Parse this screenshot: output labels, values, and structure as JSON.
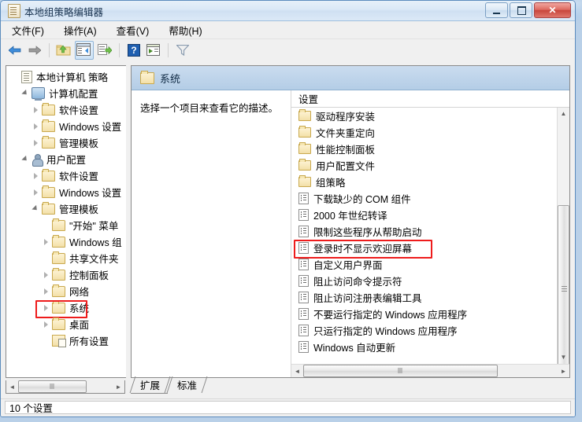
{
  "window": {
    "title": "本地组策略编辑器",
    "app_icon": "policy-document-icon",
    "buttons": {
      "minimize": "minimize",
      "maximize": "maximize",
      "close": "✕"
    }
  },
  "menubar": {
    "items": [
      {
        "label": "文件(F)",
        "name": "menu-file"
      },
      {
        "label": "操作(A)",
        "name": "menu-action"
      },
      {
        "label": "查看(V)",
        "name": "menu-view"
      },
      {
        "label": "帮助(H)",
        "name": "menu-help"
      }
    ]
  },
  "toolbar": {
    "items": [
      {
        "name": "back-icon",
        "glyph": "←"
      },
      {
        "name": "forward-icon",
        "glyph": "→"
      },
      {
        "name": "up-folder-icon",
        "glyph": "↑"
      },
      {
        "name": "show-hide-tree-icon",
        "glyph": "▤"
      },
      {
        "name": "export-list-icon",
        "glyph": "➦"
      },
      {
        "name": "help-icon",
        "glyph": "?"
      },
      {
        "name": "properties-icon",
        "glyph": "▦"
      },
      {
        "name": "filter-icon",
        "glyph": "▽"
      }
    ]
  },
  "tree": {
    "root_label": "本地计算机 策略",
    "nodes": [
      {
        "label": "本地计算机 策略",
        "indent": 0,
        "icon": "policy-document-icon",
        "twist": "none",
        "highlight": false
      },
      {
        "label": "计算机配置",
        "indent": 1,
        "icon": "computer-icon",
        "twist": "expanded",
        "highlight": false
      },
      {
        "label": "软件设置",
        "indent": 2,
        "icon": "folder-icon",
        "twist": "collapsed",
        "highlight": false
      },
      {
        "label": "Windows 设置",
        "indent": 2,
        "icon": "folder-icon",
        "twist": "collapsed",
        "highlight": false
      },
      {
        "label": "管理模板",
        "indent": 2,
        "icon": "folder-icon",
        "twist": "collapsed",
        "highlight": false
      },
      {
        "label": "用户配置",
        "indent": 1,
        "icon": "user-icon",
        "twist": "expanded",
        "highlight": false
      },
      {
        "label": "软件设置",
        "indent": 2,
        "icon": "folder-icon",
        "twist": "collapsed",
        "highlight": false
      },
      {
        "label": "Windows 设置",
        "indent": 2,
        "icon": "folder-icon",
        "twist": "collapsed",
        "highlight": false
      },
      {
        "label": "管理模板",
        "indent": 2,
        "icon": "folder-icon",
        "twist": "expanded",
        "highlight": false
      },
      {
        "label": "\"开始\" 菜单",
        "indent": 3,
        "icon": "folder-icon",
        "twist": "none",
        "highlight": false
      },
      {
        "label": "Windows 组",
        "indent": 3,
        "icon": "folder-icon",
        "twist": "collapsed",
        "highlight": false
      },
      {
        "label": "共享文件夹",
        "indent": 3,
        "icon": "folder-icon",
        "twist": "none",
        "highlight": false
      },
      {
        "label": "控制面板",
        "indent": 3,
        "icon": "folder-icon",
        "twist": "collapsed",
        "highlight": false
      },
      {
        "label": "网络",
        "indent": 3,
        "icon": "folder-icon",
        "twist": "collapsed",
        "highlight": false
      },
      {
        "label": "系统",
        "indent": 3,
        "icon": "folder-icon",
        "twist": "collapsed",
        "highlight": true
      },
      {
        "label": "桌面",
        "indent": 3,
        "icon": "folder-icon",
        "twist": "collapsed",
        "highlight": false
      },
      {
        "label": "所有设置",
        "indent": 3,
        "icon": "all-settings-icon",
        "twist": "none",
        "highlight": false
      }
    ]
  },
  "detail": {
    "header_title": "系统",
    "header_icon": "folder-icon",
    "description": "选择一个项目来查看它的描述。",
    "list_column_header": "设置",
    "rows": [
      {
        "label": "驱动程序安装",
        "icon": "folder-icon",
        "highlight": false
      },
      {
        "label": "文件夹重定向",
        "icon": "folder-icon",
        "highlight": false
      },
      {
        "label": "性能控制面板",
        "icon": "folder-icon",
        "highlight": false
      },
      {
        "label": "用户配置文件",
        "icon": "folder-icon",
        "highlight": false
      },
      {
        "label": "组策略",
        "icon": "folder-icon",
        "highlight": false
      },
      {
        "label": "下载缺少的 COM 组件",
        "icon": "policy-icon",
        "highlight": false
      },
      {
        "label": "2000 年世纪转译",
        "icon": "policy-icon",
        "highlight": false
      },
      {
        "label": "限制这些程序从帮助启动",
        "icon": "policy-icon",
        "highlight": false
      },
      {
        "label": "登录时不显示欢迎屏幕",
        "icon": "policy-icon",
        "highlight": true
      },
      {
        "label": "自定义用户界面",
        "icon": "policy-icon",
        "highlight": false
      },
      {
        "label": "阻止访问命令提示符",
        "icon": "policy-icon",
        "highlight": false
      },
      {
        "label": "阻止访问注册表编辑工具",
        "icon": "policy-icon",
        "highlight": false
      },
      {
        "label": "不要运行指定的 Windows 应用程序",
        "icon": "policy-icon",
        "highlight": false
      },
      {
        "label": "只运行指定的 Windows 应用程序",
        "icon": "policy-icon",
        "highlight": false
      },
      {
        "label": "Windows 自动更新",
        "icon": "policy-icon",
        "highlight": false
      }
    ]
  },
  "tabs": [
    {
      "label": "扩展",
      "active": false
    },
    {
      "label": "标准",
      "active": true
    }
  ],
  "statusbar": {
    "text": "10 个设置"
  },
  "colors": {
    "highlight_red": "#ee1c1c",
    "header_blue": "#b4cde6",
    "window_border": "#5b8bbd"
  }
}
